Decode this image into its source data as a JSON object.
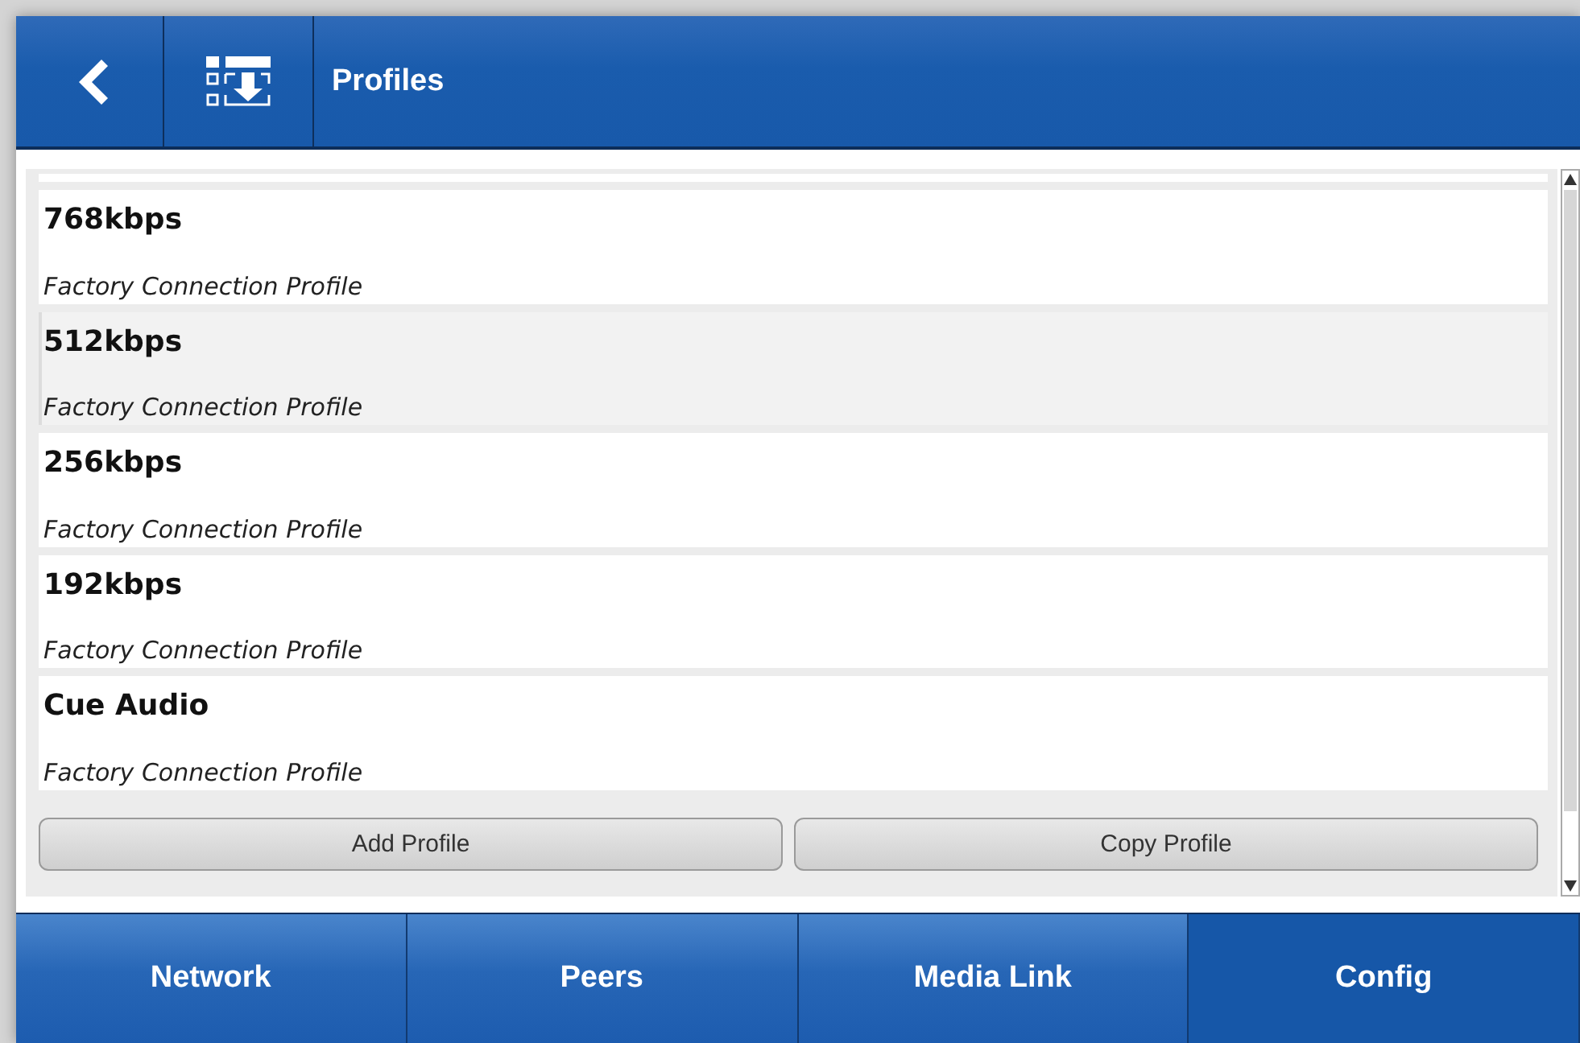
{
  "header": {
    "title": "Profiles"
  },
  "profiles": [
    {
      "name": "768kbps",
      "description": "Factory Connection Profile",
      "selected": false
    },
    {
      "name": "512kbps",
      "description": "Factory Connection Profile",
      "selected": true
    },
    {
      "name": "256kbps",
      "description": "Factory Connection Profile",
      "selected": false
    },
    {
      "name": "192kbps",
      "description": "Factory Connection Profile",
      "selected": false
    },
    {
      "name": "Cue Audio",
      "description": "Factory Connection Profile",
      "selected": false
    }
  ],
  "buttons": [
    "Add Profile",
    "Copy Profile"
  ],
  "nav_tabs": [
    {
      "label": "Network",
      "selected": false
    },
    {
      "label": "Peers",
      "selected": false
    },
    {
      "label": "Media Link",
      "selected": false
    },
    {
      "label": "Config",
      "selected": true
    }
  ]
}
